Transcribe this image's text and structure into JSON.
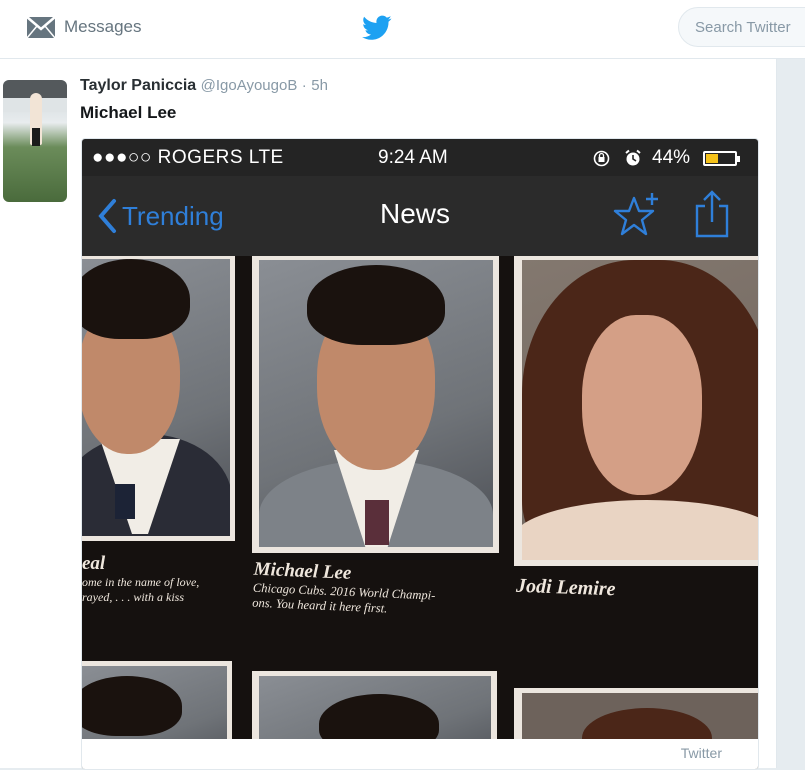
{
  "topbar": {
    "messages_label": "Messages",
    "search_placeholder": "Search Twitter"
  },
  "tweet": {
    "author_name": "Taylor Paniccia",
    "author_handle": "@IgoAyougoB",
    "separator": "·",
    "timestamp": "5h",
    "text": "Michael Lee",
    "card_source": "Twitter"
  },
  "phone_screenshot": {
    "carrier": "●●●○○ ROGERS  LTE",
    "clock": "9:24 AM",
    "battery": "44%",
    "back_label": "Trending",
    "title": "News",
    "captions": {
      "left_name": "eal",
      "left_line1": "ome in the name of love,",
      "left_line2": "rayed, . . . with a kiss",
      "center_name": "Michael Lee",
      "center_line1": "Chicago Cubs. 2016 World Champi-",
      "center_line2": "ons. You heard it here first.",
      "right_name": "Jodi Lemire"
    }
  },
  "colors": {
    "twitter_blue": "#1da1f2",
    "ios_blue": "#2f7fd9",
    "battery_yellow": "#f4c21b"
  }
}
